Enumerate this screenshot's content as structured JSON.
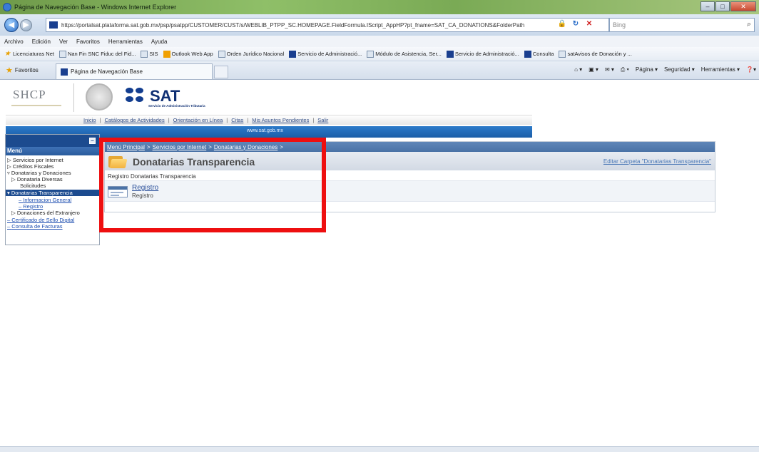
{
  "window": {
    "title": "Página de Navegación Base - Windows Internet Explorer",
    "buttons": {
      "minimize": "–",
      "maximize": "□",
      "close": "✕"
    }
  },
  "address": {
    "url": "https://portalsat.plataforma.sat.gob.mx/psp/psatpp/CUSTOMER/CUST/s/WEBLIB_PTPP_SC.HOMEPAGE.FieldFormula.IScript_AppHP?pt_fname=SAT_CA_DONATIONS&FolderPath",
    "search_placeholder": "Bing"
  },
  "menu": [
    "Archivo",
    "Edición",
    "Ver",
    "Favoritos",
    "Herramientas",
    "Ayuda"
  ],
  "links": [
    "Licenciaturas Net",
    "Nan Fin SNC Fiduc del Fid...",
    "SIS",
    "Outlook Web App",
    "Orden Jurídico Nacional",
    "Servicio de Administració...",
    "Módulo de Asistencia, Ser...",
    "Servicio de Administració...",
    "Consulta",
    "satAvisos de Donación y ..."
  ],
  "favbar": {
    "favorites_label": "Favoritos",
    "tab_title": "Página de Navegación Base",
    "commands": [
      "Página ▾",
      "Seguridad ▾",
      "Herramientas ▾"
    ]
  },
  "header": {
    "shcp": "SHCP",
    "sat": "SAT",
    "sat_sub": "Servicio de Administración Tributaria",
    "www": "www.sat.gob.mx",
    "nav": [
      "Inicio",
      "Catálogos de Actividades",
      "Orientación en Línea",
      "Citas",
      "Mis Asuntos Pendientes",
      "Salir"
    ]
  },
  "sidebar": {
    "collapse": "–",
    "menu_header": "Menú",
    "items": [
      "Servicios por Internet",
      "Créditos Fiscales",
      "Donatarias y Donaciones",
      "Donataria Diversas",
      "Solicitudes",
      "Donatarias Transparencia",
      "Informacion General",
      "Registro",
      "Donaciones del Extranjero",
      "Certificado de Sello Digital",
      "Consulta de Facturas"
    ]
  },
  "main": {
    "breadcrumb": [
      "Menú Principal",
      "Servicios por Internet",
      "Donatarias y Donaciones"
    ],
    "title": "Donatarias Transparencia",
    "edit_folder": "Editar Carpeta \"Donatarias Transparencia\"",
    "section_label": "Registro Donatarias Transparencia",
    "item_title": "Registro",
    "item_desc": "Registro"
  },
  "colors": {
    "highlight": "#ee0f10",
    "sat_blue": "#0f2f73",
    "header_strip": "#1b5ea8",
    "sidebar_selected": "#1c4b8f"
  }
}
